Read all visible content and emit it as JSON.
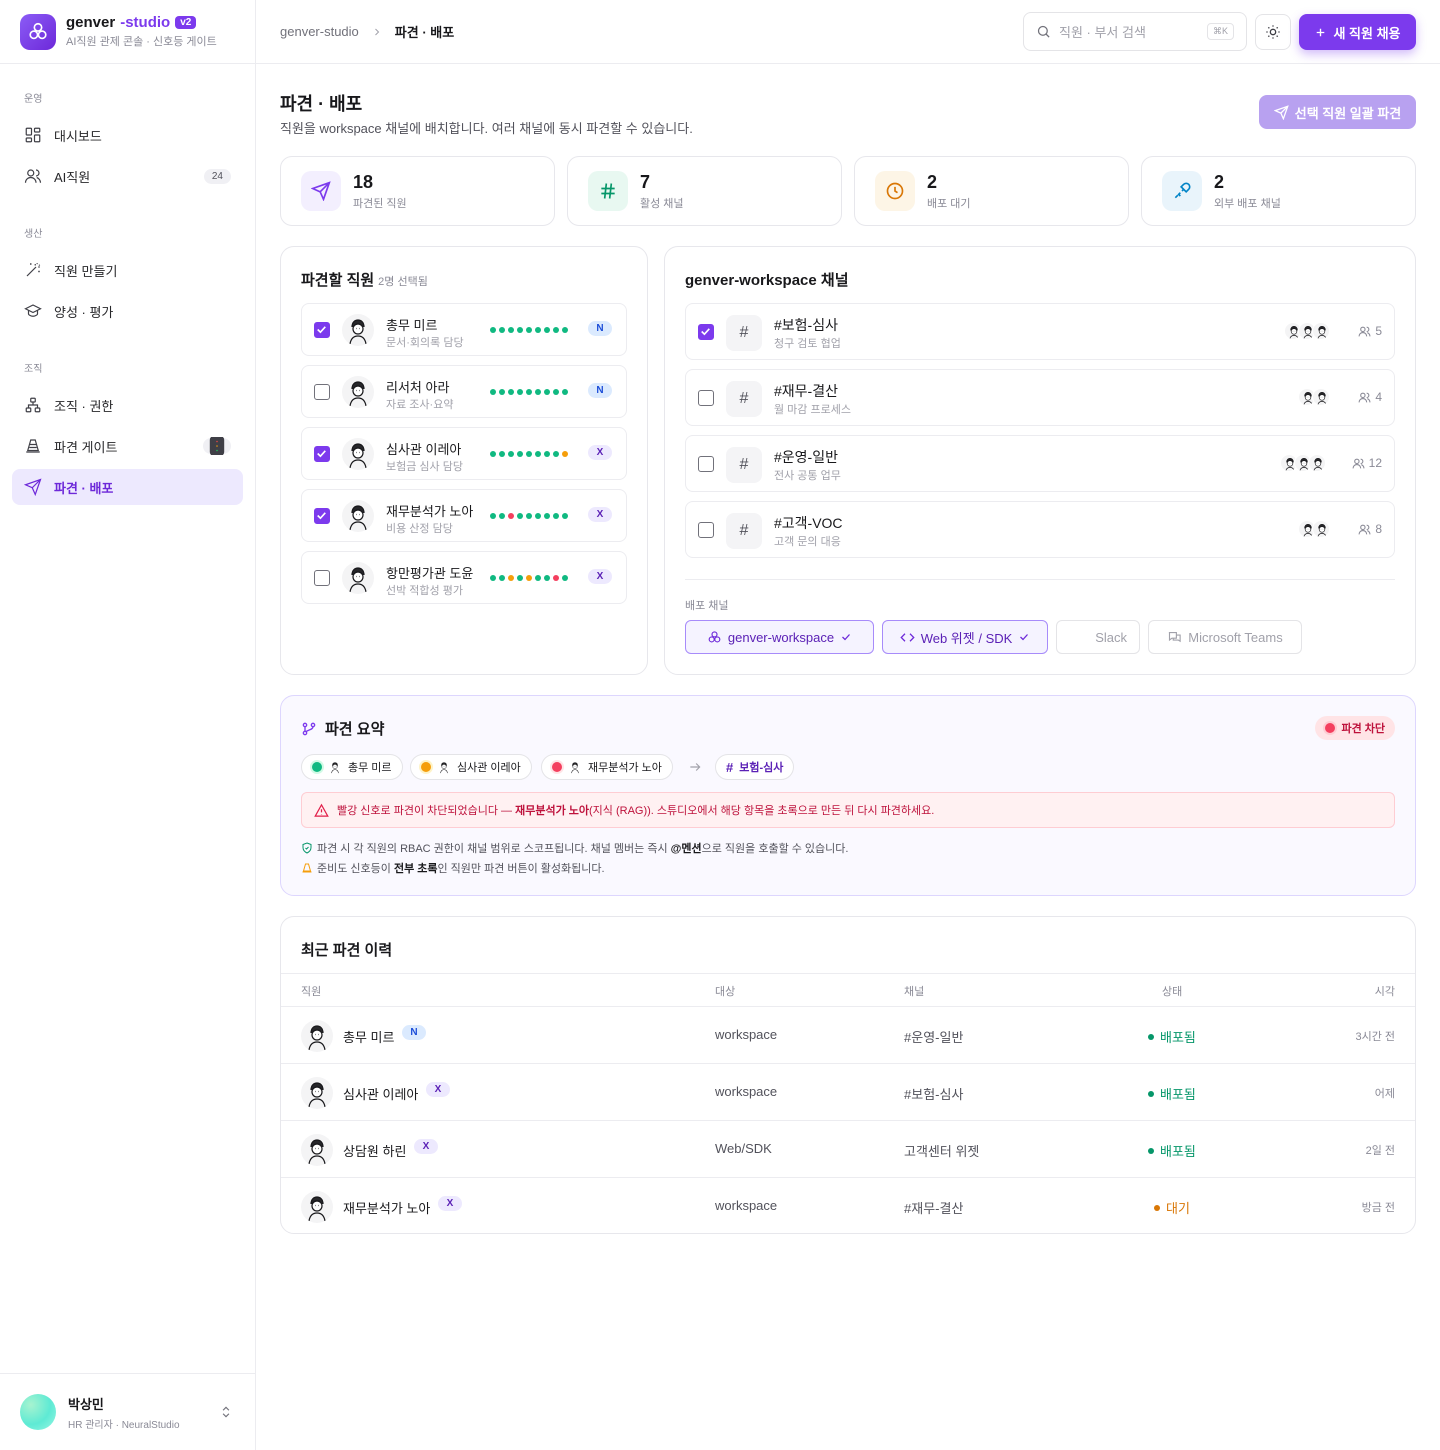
{
  "brand": {
    "name": "genver",
    "studio": "-studio",
    "version": "v2",
    "subtitle": "AI직원 관제 콘솔 · 신호등 게이트"
  },
  "sidebar": {
    "sections": [
      "운영",
      "생산",
      "조직"
    ],
    "items": [
      {
        "label": "대시보드",
        "icon": "dashboard-icon"
      },
      {
        "label": "AI직원",
        "icon": "users-icon",
        "count": "24"
      },
      {
        "label": "직원 만들기",
        "icon": "wand-icon"
      },
      {
        "label": "양성 · 평가",
        "icon": "graduation-cap-icon"
      },
      {
        "label": "조직 · 권한",
        "icon": "org-chart-icon"
      },
      {
        "label": "파견 게이트",
        "icon": "cone-icon",
        "badge": "traffic-light-icon"
      },
      {
        "label": "파견 · 배포",
        "icon": "send-icon",
        "active": true
      }
    ]
  },
  "user": {
    "name": "박상민",
    "role": "HR 관리자 · NeuralStudio"
  },
  "topbar": {
    "breadcrumb": [
      "genver-studio",
      "파견 · 배포"
    ],
    "search_placeholder": "직원 · 부서 검색",
    "search_kbd": "⌘K",
    "new_button": "새 직원 채용"
  },
  "page": {
    "title": "파견 · 배포",
    "subtitle": "직원을 workspace 채널에 배치합니다. 여러 채널에 동시 파견할 수 있습니다.",
    "bulk_button": "선택 직원 일괄 파견"
  },
  "stats": [
    {
      "value": "18",
      "label": "파견된 직원",
      "icon": "send-icon",
      "color": "#7c3aed",
      "bg": "#f3effe"
    },
    {
      "value": "7",
      "label": "활성 채널",
      "icon": "hash-icon",
      "color": "#059669",
      "bg": "#e8f8f1"
    },
    {
      "value": "2",
      "label": "배포 대기",
      "icon": "clock-icon",
      "color": "#d97706",
      "bg": "#fdf5e6"
    },
    {
      "value": "2",
      "label": "외부 배포 채널",
      "icon": "plug-icon",
      "color": "#0284c7",
      "bg": "#e9f4fb"
    }
  ],
  "employees_card": {
    "title": "파견할 직원",
    "selected": "2명 선택됨"
  },
  "employees": [
    {
      "name": "총무 미르",
      "role": "문서·회의록 담당",
      "checked": true,
      "tag": "N",
      "dots": [
        "g",
        "g",
        "g",
        "g",
        "g",
        "g",
        "g",
        "g",
        "g",
        "g",
        "g"
      ]
    },
    {
      "name": "리서처 아라",
      "role": "자료 조사·요약",
      "checked": false,
      "tag": "N",
      "dots": [
        "g",
        "g",
        "g",
        "g",
        "g",
        "g",
        "g",
        "g",
        "g",
        "g",
        "g"
      ]
    },
    {
      "name": "심사관 이레아",
      "role": "보험금 심사 담당",
      "checked": true,
      "tag": "X",
      "dots": [
        "g",
        "g",
        "g",
        "g",
        "g",
        "g",
        "g",
        "g",
        "o",
        "g",
        "g"
      ]
    },
    {
      "name": "재무분석가 노아",
      "role": "비용 산정 담당",
      "checked": true,
      "tag": "X",
      "dots": [
        "g",
        "g",
        "r",
        "g",
        "g",
        "g",
        "g",
        "g",
        "g",
        "g",
        "o"
      ]
    },
    {
      "name": "항만평가관 도윤",
      "role": "선박 적합성 평가",
      "checked": false,
      "tag": "X",
      "dots": [
        "g",
        "g",
        "o",
        "g",
        "o",
        "g",
        "g",
        "r",
        "g",
        "g",
        "r"
      ]
    }
  ],
  "channels_card": {
    "title": "genver-workspace 채널",
    "deploy_label": "배포 채널"
  },
  "channels": [
    {
      "name": "#보험-심사",
      "desc": "청구 검토 협업",
      "checked": true,
      "members": "5",
      "heads": 3
    },
    {
      "name": "#재무-결산",
      "desc": "월 마감 프로세스",
      "checked": false,
      "members": "4",
      "heads": 2
    },
    {
      "name": "#운영-일반",
      "desc": "전사 공통 업무",
      "checked": false,
      "members": "12",
      "heads": 3
    },
    {
      "name": "#고객-VOC",
      "desc": "고객 문의 대응",
      "checked": false,
      "members": "8",
      "heads": 2
    }
  ],
  "deploy_channels": [
    {
      "label": "genver-workspace",
      "active": true,
      "icon": "logo-icon"
    },
    {
      "label": "Web 위젯 / SDK",
      "active": true,
      "icon": "code-icon"
    },
    {
      "label": "Slack",
      "active": false,
      "icon": ""
    },
    {
      "label": "Microsoft Teams",
      "active": false,
      "icon": "teams-icon"
    }
  ],
  "summary": {
    "title": "파견 요약",
    "status": "파견 차단",
    "chips": [
      {
        "name": "총무 미르",
        "color": "#10b981"
      },
      {
        "name": "심사관 이레아",
        "color": "#f59e0b"
      },
      {
        "name": "재무분석가 노아",
        "color": "#f43f5e"
      }
    ],
    "target": "보험-심사",
    "alert_pre": "빨강 신호로 파견이 차단되었습니다 — ",
    "alert_name": "재무분석가 노아",
    "alert_post": "(지식 (RAG)). 스튜디오에서 해당 항목을 초록으로 만든 뒤 다시 파견하세요.",
    "note1_pre": "파견 시 각 직원의 RBAC 권한이 채널 범위로 스코프됩니다. 채널 멤버는 즉시 ",
    "note1_bold": "@멘션",
    "note1_post": "으로 직원을 호출할 수 있습니다.",
    "note2_pre": "준비도 신호등이 ",
    "note2_bold": "전부 초록",
    "note2_post": "인 직원만 파견 버튼이 활성화됩니다."
  },
  "history": {
    "title": "최근 파견 이력",
    "columns": [
      "직원",
      "대상",
      "채널",
      "상태",
      "시각"
    ],
    "rows": [
      {
        "name": "총무 미르",
        "tag": "N",
        "target": "workspace",
        "channel": "#운영-일반",
        "status": "배포됨",
        "status_color": "#059669",
        "time": "3시간 전"
      },
      {
        "name": "심사관 이레아",
        "tag": "X",
        "target": "workspace",
        "channel": "#보험-심사",
        "status": "배포됨",
        "status_color": "#059669",
        "time": "어제"
      },
      {
        "name": "상담원 하린",
        "tag": "X",
        "target": "Web/SDK",
        "channel": "고객센터 위젯",
        "status": "배포됨",
        "status_color": "#059669",
        "time": "2일 전"
      },
      {
        "name": "재무분석가 노아",
        "tag": "X",
        "target": "workspace",
        "channel": "#재무-결산",
        "status": "대기",
        "status_color": "#d97706",
        "time": "방금 전"
      }
    ]
  }
}
